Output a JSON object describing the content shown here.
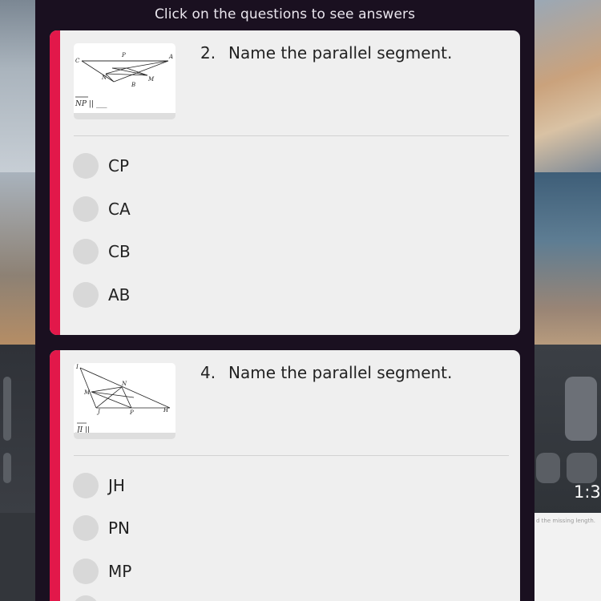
{
  "header": {
    "instruction": "Click on the questions to see answers"
  },
  "questions": [
    {
      "number": "2.",
      "prompt": "Name the parallel segment.",
      "figure": {
        "caption": "NP ||",
        "caption_blank": "___",
        "labels": {
          "c": "C",
          "p": "P",
          "a": "A",
          "n": "N",
          "m": "M",
          "b": "B"
        }
      },
      "options": [
        {
          "label": "CP"
        },
        {
          "label": "CA"
        },
        {
          "label": "CB"
        },
        {
          "label": "AB"
        }
      ]
    },
    {
      "number": "4.",
      "prompt": "Name the parallel segment.",
      "figure": {
        "caption": "JI ||",
        "caption_blank": "___",
        "labels": {
          "i": "I",
          "m": "M",
          "n": "N",
          "j": "J",
          "p": "P",
          "h": "H"
        }
      },
      "options": [
        {
          "label": "JH"
        },
        {
          "label": "PN"
        },
        {
          "label": "MP"
        }
      ]
    }
  ],
  "background": {
    "time": "1:3",
    "note": "d the missing length."
  },
  "colors": {
    "panel": "#1a1020",
    "card": "#efefef",
    "accent": "#e2184a",
    "radio": "#d8d8d8"
  }
}
